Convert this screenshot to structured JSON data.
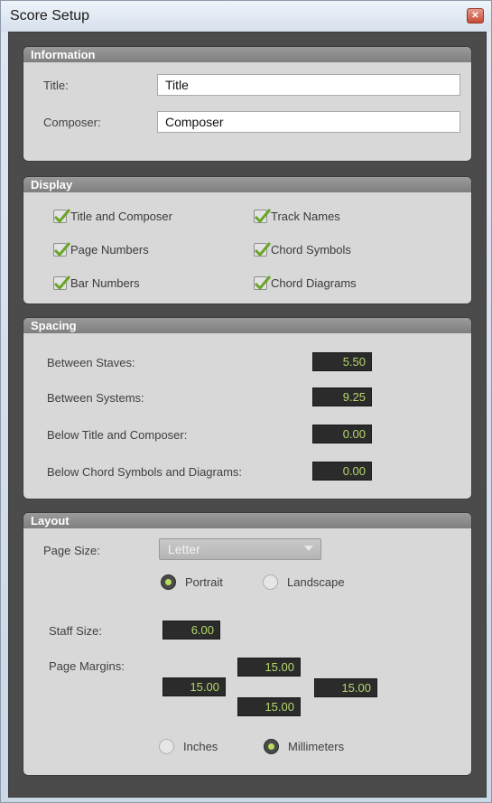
{
  "window": {
    "title": "Score Setup"
  },
  "information": {
    "header": "Information",
    "title_label": "Title:",
    "title_value": "Title",
    "composer_label": "Composer:",
    "composer_value": "Composer"
  },
  "display": {
    "header": "Display",
    "options": [
      {
        "label": "Title and Composer",
        "checked": true
      },
      {
        "label": "Page Numbers",
        "checked": true
      },
      {
        "label": "Bar Numbers",
        "checked": true
      },
      {
        "label": "Track Names",
        "checked": true
      },
      {
        "label": "Chord Symbols",
        "checked": true
      },
      {
        "label": "Chord Diagrams",
        "checked": true
      }
    ]
  },
  "spacing": {
    "header": "Spacing",
    "between_staves_label": "Between Staves:",
    "between_staves_value": "5.50",
    "between_systems_label": "Between Systems:",
    "between_systems_value": "9.25",
    "below_title_label": "Below Title and Composer:",
    "below_title_value": "0.00",
    "below_chord_label": "Below Chord Symbols and Diagrams:",
    "below_chord_value": "0.00"
  },
  "layout": {
    "header": "Layout",
    "page_size_label": "Page Size:",
    "page_size_value": "Letter",
    "portrait_label": "Portrait",
    "landscape_label": "Landscape",
    "orientation_selected": "Portrait",
    "staff_size_label": "Staff Size:",
    "staff_size_value": "6.00",
    "page_margins_label": "Page Margins:",
    "margin_top": "15.00",
    "margin_left": "15.00",
    "margin_right": "15.00",
    "margin_bottom": "15.00",
    "inches_label": "Inches",
    "millimeters_label": "Millimeters",
    "units_selected": "Millimeters"
  },
  "colors": {
    "accent_green": "#b8db5a",
    "panel_bg": "#d8d8d8",
    "window_bg": "#4b4b4b"
  }
}
